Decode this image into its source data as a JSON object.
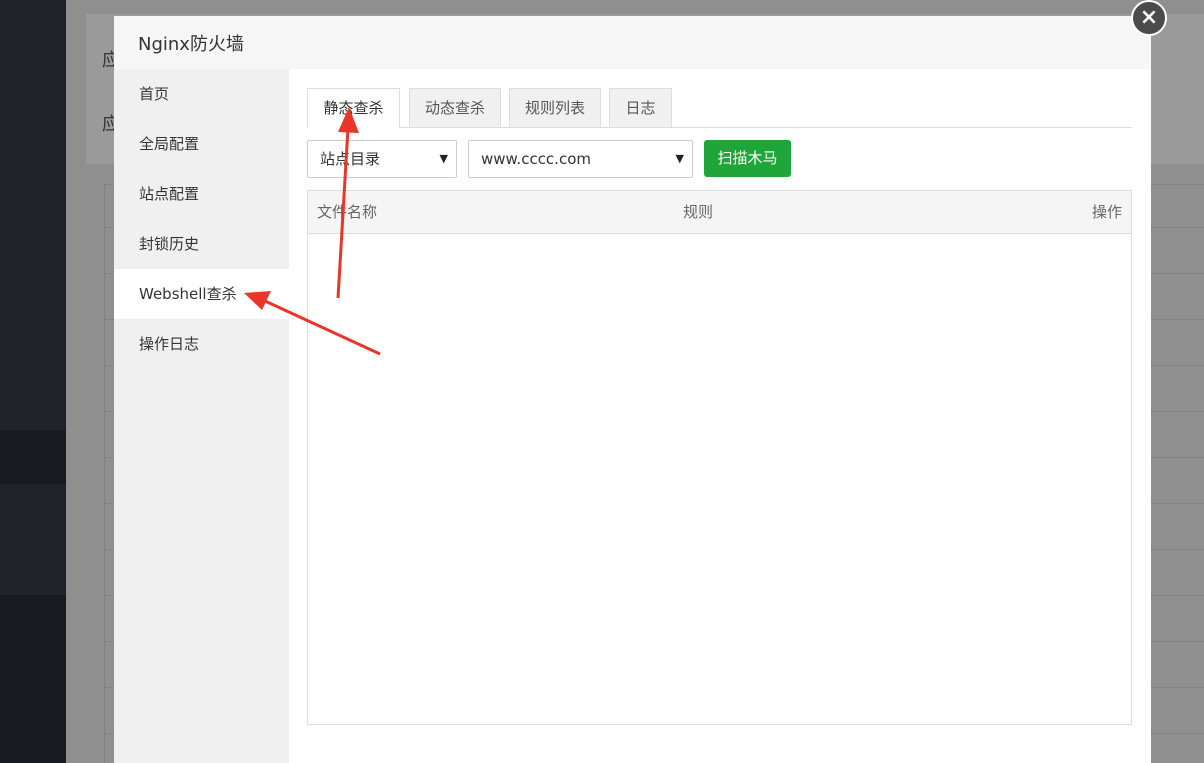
{
  "background": {
    "partial_labels": [
      "应",
      "应"
    ]
  },
  "modal": {
    "title": "Nginx防火墙",
    "close_label": "×"
  },
  "sidebar": {
    "items": [
      {
        "label": "首页"
      },
      {
        "label": "全局配置"
      },
      {
        "label": "站点配置"
      },
      {
        "label": "封锁历史"
      },
      {
        "label": "Webshell查杀",
        "active": true
      },
      {
        "label": "操作日志"
      }
    ]
  },
  "tabs": [
    {
      "label": "静态查杀",
      "active": true
    },
    {
      "label": "动态查杀"
    },
    {
      "label": "规则列表"
    },
    {
      "label": "日志"
    }
  ],
  "filters": {
    "dir_select": {
      "value": "站点目录"
    },
    "site_select": {
      "value": "www.cccc.com"
    },
    "caret": "▼",
    "scan_button": "扫描木马"
  },
  "table": {
    "columns": [
      "文件名称",
      "规则",
      "操作"
    ],
    "rows": []
  },
  "colors": {
    "accent_green": "#20a53a",
    "annotation_red": "#e8362b"
  },
  "icons": [
    "close-icon",
    "dropdown-caret-icon"
  ]
}
